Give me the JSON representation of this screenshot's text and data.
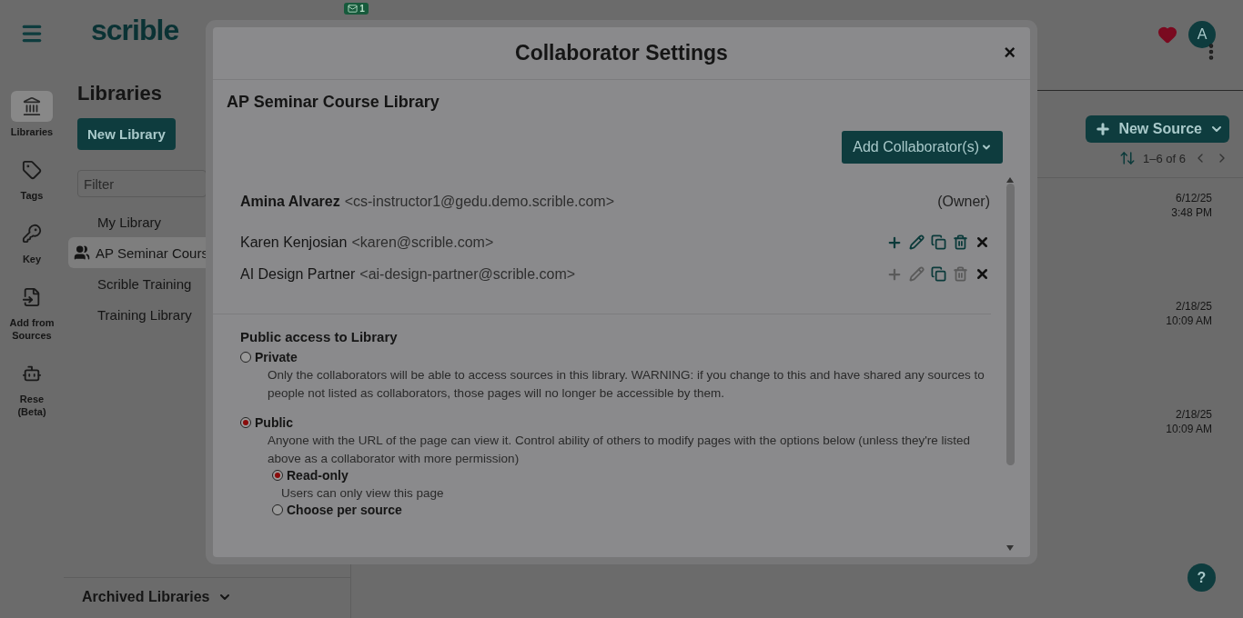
{
  "app": {
    "logo": "scrible",
    "mail_badge": "1",
    "avatar": "A",
    "help": "?"
  },
  "nav": [
    {
      "label": "Libraries",
      "kind": "library",
      "selected": true
    },
    {
      "label": "Tags",
      "kind": "tags",
      "selected": false
    },
    {
      "label": "Key",
      "kind": "key",
      "selected": false
    },
    {
      "label": "Add from Sources",
      "kind": "import",
      "selected": false
    },
    {
      "label": "Rese (Beta)",
      "kind": "bot",
      "selected": false
    }
  ],
  "libraries": {
    "title": "Libraries",
    "new_button": "New Library",
    "filter_placeholder": "Filter",
    "items": [
      {
        "label": "My Library",
        "shared": false,
        "selected": false
      },
      {
        "label": "AP Seminar Cours",
        "shared": true,
        "selected": true
      },
      {
        "label": "Scrible Training",
        "shared": false,
        "selected": false
      },
      {
        "label": "Training Library",
        "shared": false,
        "selected": false
      }
    ],
    "archived": "Archived Libraries"
  },
  "sources": {
    "new_button": "New Source",
    "range": "1–6 of 6",
    "dates": [
      {
        "date": "6/12/25",
        "time": "3:48 PM"
      },
      {
        "date": "2/18/25",
        "time": "10:09 AM"
      },
      {
        "date": "2/18/25",
        "time": "10:09 AM"
      }
    ]
  },
  "modal": {
    "title": "Collaborator Settings",
    "close": "×",
    "library": "AP Seminar Course Library",
    "add_button": "Add Collaborator(s)",
    "collaborators": [
      {
        "name": "Amina Alvarez",
        "email": "<cs-instructor1@gedu.demo.scrible.com>",
        "owner": true,
        "role": "(Owner)"
      },
      {
        "name": "Karen Kenjosian",
        "email": "<karen@scrible.com>",
        "owner": false,
        "actions": [
          {
            "kind": "add",
            "disabled": false
          },
          {
            "kind": "edit",
            "disabled": false
          },
          {
            "kind": "copy",
            "disabled": false
          },
          {
            "kind": "delete",
            "disabled": false
          },
          {
            "kind": "remove",
            "disabled": false
          }
        ]
      },
      {
        "name": "AI Design Partner",
        "email": "<ai-design-partner@scrible.com>",
        "owner": false,
        "actions": [
          {
            "kind": "add",
            "disabled": true
          },
          {
            "kind": "edit",
            "disabled": true
          },
          {
            "kind": "copy",
            "disabled": false
          },
          {
            "kind": "delete",
            "disabled": true
          },
          {
            "kind": "remove",
            "disabled": false
          }
        ]
      }
    ],
    "access_title": "Public access to Library",
    "options": [
      {
        "label": "Private",
        "selected": false,
        "description": "Only the collaborators will be able to access sources in this library. WARNING: if you change to this and have shared any sources to people not listed as collaborators, those pages will no longer be accessible by them."
      },
      {
        "label": "Public",
        "selected": true,
        "description": "Anyone with the URL of the page can view it. Control ability of others to modify pages with the options below (unless they're listed above as a collaborator with more permission)",
        "suboptions": [
          {
            "label": "Read-only",
            "selected": true,
            "description": "Users can only view this page"
          },
          {
            "label": "Choose per source",
            "selected": false
          }
        ]
      }
    ]
  }
}
